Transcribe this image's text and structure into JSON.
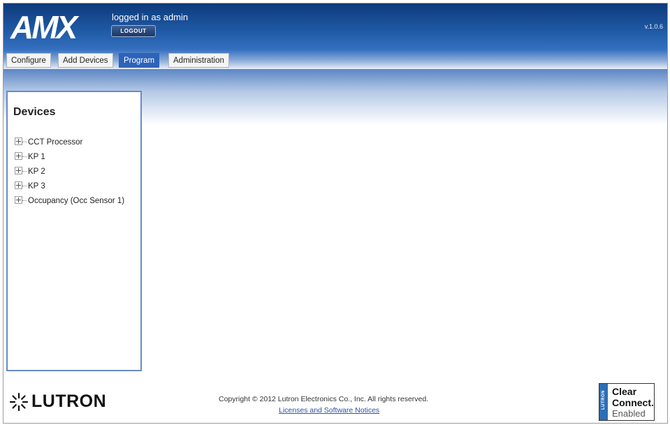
{
  "header": {
    "brand": "AMX",
    "login_text": "logged in as admin",
    "logout_label": "LOGOUT",
    "version": "v.1.0.6"
  },
  "tabs": [
    {
      "label": "Configure",
      "active": false
    },
    {
      "label": "Add Devices",
      "active": false
    },
    {
      "label": "Program",
      "active": true
    },
    {
      "label": "Administration",
      "active": false
    }
  ],
  "devices": {
    "title": "Devices",
    "items": [
      {
        "label": "CCT Processor"
      },
      {
        "label": "KP 1"
      },
      {
        "label": "KP 2"
      },
      {
        "label": "KP 3"
      },
      {
        "label": "Occupancy (Occ Sensor 1)"
      }
    ]
  },
  "footer": {
    "lutron_logo": "LUTRON",
    "copyright": "Copyright © 2012 Lutron Electronics Co., Inc. All rights reserved.",
    "licenses_link": "Licenses and Software Notices",
    "badge": {
      "strip": "LUTRON",
      "line1": "Clear",
      "line2": "Connect.",
      "line3": "Enabled"
    }
  },
  "colors": {
    "header_blue": "#1f5aa6",
    "active_tab": "#2d63b8",
    "link": "#2a52a6",
    "badge_blue": "#2c6fb6"
  }
}
